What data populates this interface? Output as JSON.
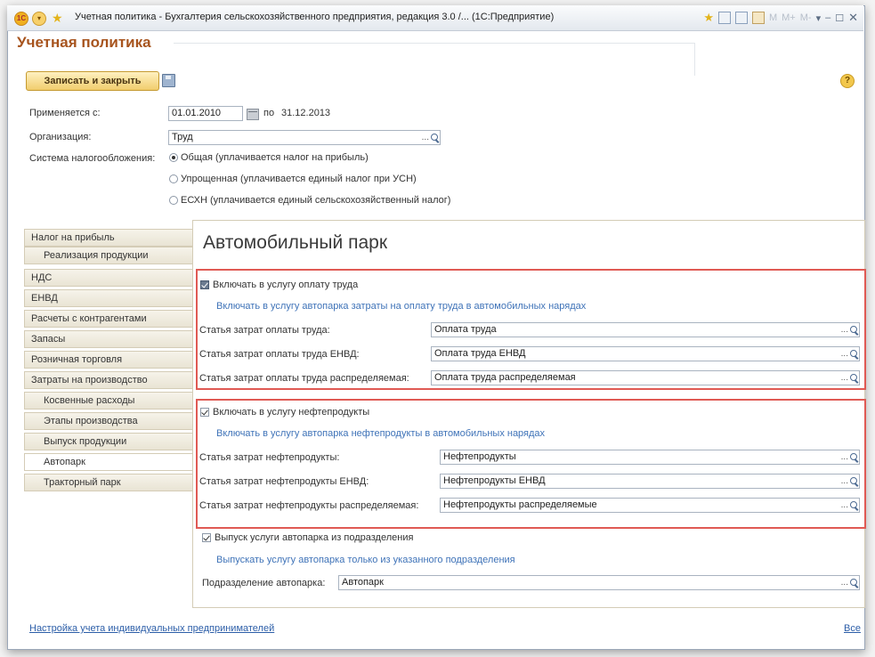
{
  "window": {
    "title": "Учетная политика - Бухгалтерия сельскохозяйственного предприятия, редакция 3.0 /... (1С:Предприятие)",
    "controls": [
      "M",
      "M+",
      "M-"
    ]
  },
  "form": {
    "title": "Учетная политика",
    "save_close_label": "Записать и закрыть",
    "help_label": "?"
  },
  "period": {
    "label": "Применяется с:",
    "from": "01.01.2010",
    "to_label": "по",
    "to": "31.12.2013"
  },
  "organization": {
    "label": "Организация:",
    "value": "Труд"
  },
  "tax_system": {
    "label": "Система налогообложения:",
    "options": [
      "Общая (уплачивается налог на прибыль)",
      "Упрощенная (уплачивается единый налог при УСН)",
      "ЕСХН (уплачивается единый сельскохозяйственный налог)"
    ],
    "selected_index": 0
  },
  "nav": {
    "items": [
      "Налог на прибыль",
      "Реализация продукции",
      "НДС",
      "ЕНВД",
      "Расчеты с контрагентами",
      "Запасы",
      "Розничная торговля",
      "Затраты на производство",
      "Косвенные расходы",
      "Этапы производства",
      "Выпуск продукции",
      "Автопарк",
      "Тракторный парк"
    ],
    "active_index": 11
  },
  "content": {
    "title": "Автомобильный парк",
    "labor": {
      "checkbox_label": "Включать в услугу оплату труда",
      "hint": "Включать в услугу автопарка затраты на оплату труда в автомобильных нарядах",
      "rows": [
        {
          "label": "Статья затрат оплаты труда:",
          "value": "Оплата труда"
        },
        {
          "label": "Статья затрат оплаты труда ЕНВД:",
          "value": "Оплата труда ЕНВД"
        },
        {
          "label": "Статья затрат оплаты труда распределяемая:",
          "value": "Оплата труда распределяемая"
        }
      ]
    },
    "fuel": {
      "checkbox_label": "Включать в услугу нефтепродукты",
      "hint": "Включать в услугу автопарка нефтепродукты в автомобильных нарядах",
      "rows": [
        {
          "label": "Статья затрат нефтепродукты:",
          "value": "Нефтепродукты"
        },
        {
          "label": "Статья затрат нефтепродукты ЕНВД:",
          "value": "Нефтепродукты ЕНВД"
        },
        {
          "label": "Статья затрат нефтепродукты распределяемая:",
          "value": "Нефтепродукты распределяемые"
        }
      ]
    },
    "division": {
      "checkbox_label": "Выпуск услуги автопарка из подразделения",
      "hint": "Выпускать услугу автопарка только из указанного подразделения",
      "label": "Подразделение автопарка:",
      "value": "Автопарк"
    }
  },
  "footer": {
    "link_label": "Настройка учета индивидуальных предпринимателей",
    "all_label": "Все"
  },
  "select_dots": "..."
}
